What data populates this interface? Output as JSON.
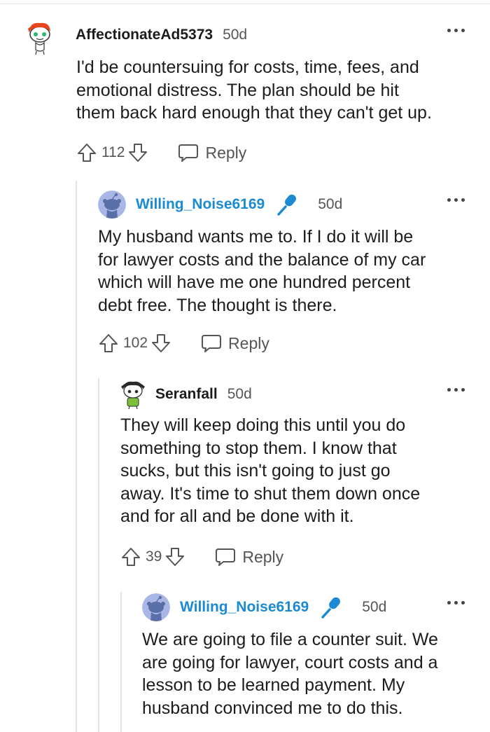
{
  "comments": [
    {
      "username": "AffectionateAd5373",
      "time": "50d",
      "avatar_icon": "snoo-avatar-red-hair",
      "lines": [
        "I'd be countersuing for costs, time, fees, and",
        "emotional distress. The plan should be hit",
        "them back hard enough that they can't get up."
      ],
      "votes": "112",
      "reply_label": "Reply"
    },
    {
      "username": "Willing_Noise6169",
      "is_op": true,
      "op_badge_icon": "microphone-icon",
      "time": "50d",
      "avatar_icon": "snoo-avatar-default",
      "lines": [
        "My husband wants me to. If I do it will be",
        "for lawyer costs and the balance of my car",
        "which will have me one hundred percent",
        "debt free. The thought is there."
      ],
      "votes": "102",
      "reply_label": "Reply"
    },
    {
      "username": "Seranfall",
      "time": "50d",
      "avatar_icon": "snoo-avatar-dark-hair",
      "lines": [
        "They will keep doing this until you do",
        "something to stop them. I know that",
        "sucks, but this isn't going to just go",
        "away. It's time to shut them down once",
        "and for all and be done with it."
      ],
      "votes": "39",
      "reply_label": "Reply"
    },
    {
      "username": "Willing_Noise6169",
      "is_op": true,
      "op_badge_icon": "microphone-icon",
      "time": "50d",
      "avatar_icon": "snoo-avatar-default",
      "lines": [
        "We are going to file a counter suit. We",
        "are going for lawyer, court costs and a",
        "lesson to be learned payment. My",
        "husband convinced me to do this."
      ]
    }
  ],
  "colors": {
    "op_username": "#1a8ad2",
    "text": "#1c1c1c",
    "meta": "#555555",
    "thread_line": "#e2e2e2"
  }
}
